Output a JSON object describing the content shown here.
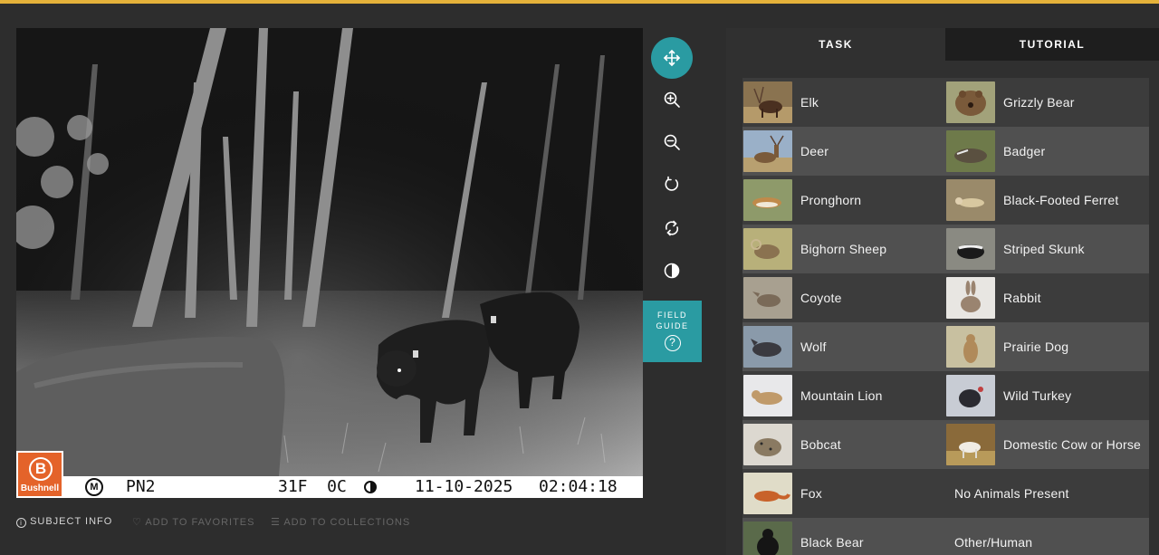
{
  "viewer": {
    "camera_brand": "Bushnell",
    "camera_mode": "M",
    "camera_id": "PN2",
    "temperature": "31F  0C",
    "date": "11-10-2025",
    "time": "02:04:18"
  },
  "tools": {
    "field_guide_line1": "FIELD",
    "field_guide_line2": "GUIDE"
  },
  "meta": {
    "subject_info": "SUBJECT INFO",
    "add_to_favorites": "ADD TO FAVORITES",
    "add_to_collections": "ADD TO COLLECTIONS"
  },
  "tabs": {
    "task": "TASK",
    "tutorial": "TUTORIAL"
  },
  "choices": [
    {
      "label": "Elk"
    },
    {
      "label": "Grizzly Bear"
    },
    {
      "label": "Deer"
    },
    {
      "label": "Badger"
    },
    {
      "label": "Pronghorn"
    },
    {
      "label": "Black-Footed Ferret"
    },
    {
      "label": "Bighorn Sheep"
    },
    {
      "label": "Striped Skunk"
    },
    {
      "label": "Coyote"
    },
    {
      "label": "Rabbit"
    },
    {
      "label": "Wolf"
    },
    {
      "label": "Prairie Dog"
    },
    {
      "label": "Mountain Lion"
    },
    {
      "label": "Wild Turkey"
    },
    {
      "label": "Bobcat"
    },
    {
      "label": "Domestic Cow or Horse"
    },
    {
      "label": "Fox"
    },
    {
      "label": "No Animals Present"
    },
    {
      "label": "Black Bear"
    },
    {
      "label": "Other/Human"
    }
  ]
}
